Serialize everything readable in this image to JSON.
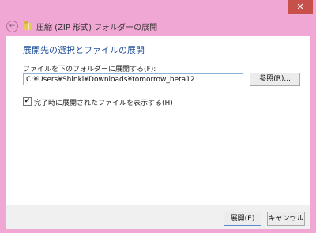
{
  "window": {
    "title": "圧縮 (ZIP 形式) フォルダーの展開",
    "close_label": "✕",
    "back_label": "←"
  },
  "content": {
    "heading": "展開先の選択とファイルの展開",
    "field_label": "ファイルを下のフォルダーに展開する(F):",
    "path_value": "C:¥Users¥Shinki¥Downloads¥tomorrow_beta12",
    "browse_label": "参照(R)...",
    "checkbox_checked": true,
    "checkbox_mark": "✔",
    "checkbox_label": "完了時に展開されたファイルを表示する(H)"
  },
  "footer": {
    "extract_label": "展開(E)",
    "cancel_label": "キャンセル"
  },
  "colors": {
    "frame": "#f1a7d3",
    "heading": "#1f4e98",
    "close": "#c7504a"
  }
}
